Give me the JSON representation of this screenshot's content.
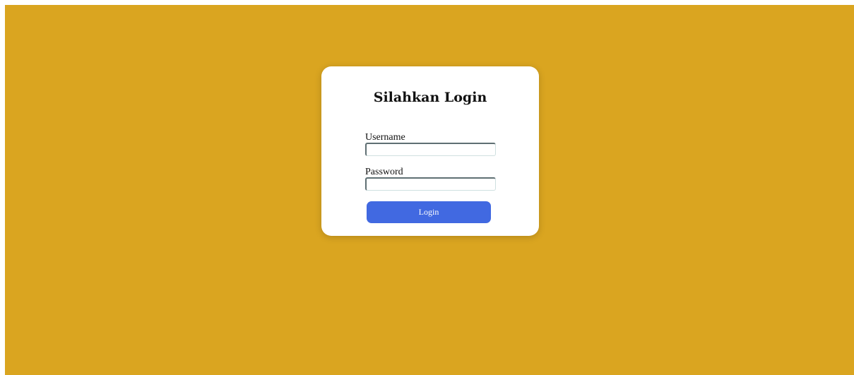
{
  "page": {
    "background_color": "#DAA520"
  },
  "login_card": {
    "title": "Silahkan Login",
    "username_label": "Username",
    "username_value": "",
    "password_label": "Password",
    "password_value": "",
    "login_button_label": "Login",
    "button_color": "#4169E1"
  }
}
